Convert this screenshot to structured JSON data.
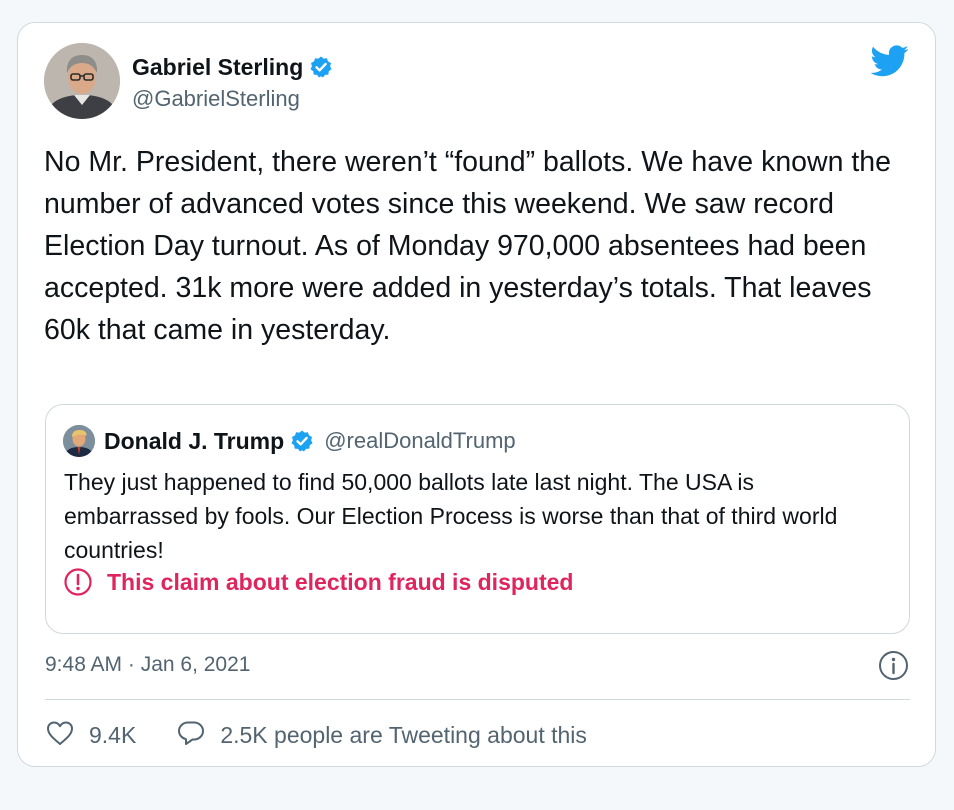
{
  "tweet": {
    "author": {
      "name": "Gabriel Sterling",
      "handle": "@GabrielSterling"
    },
    "text": "No Mr. President, there weren’t “found” ballots. We have known the number of advanced votes since this weekend. We saw record Election Day turnout. As of Monday 970,000 absentees had been accepted. 31k more were added in yesterday’s totals. That leaves 60k that came in yesterday.",
    "timestamp": "9:48 AM · Jan 6, 2021",
    "likes": "9.4K",
    "conversation": "2.5K people are Tweeting about this"
  },
  "quoted": {
    "author": {
      "name": "Donald J. Trump",
      "handle": "@realDonaldTrump"
    },
    "text": "They just happened to find 50,000 ballots late last night. The USA is embarrassed by fools. Our Election Process is worse than that of third world countries!",
    "warning": "This claim about election fraud is disputed"
  },
  "icons": {
    "brand": "twitter-bird-icon",
    "verified": "verified-badge-icon",
    "warning": "alert-circle-icon",
    "info": "info-icon",
    "like": "heart-icon",
    "reply": "speech-bubble-icon"
  },
  "colors": {
    "brand_blue": "#1da1f2",
    "warning_red": "#e0245e",
    "secondary_text": "#536471",
    "border": "#cfd9de",
    "page_background": "#f5f8fa"
  }
}
